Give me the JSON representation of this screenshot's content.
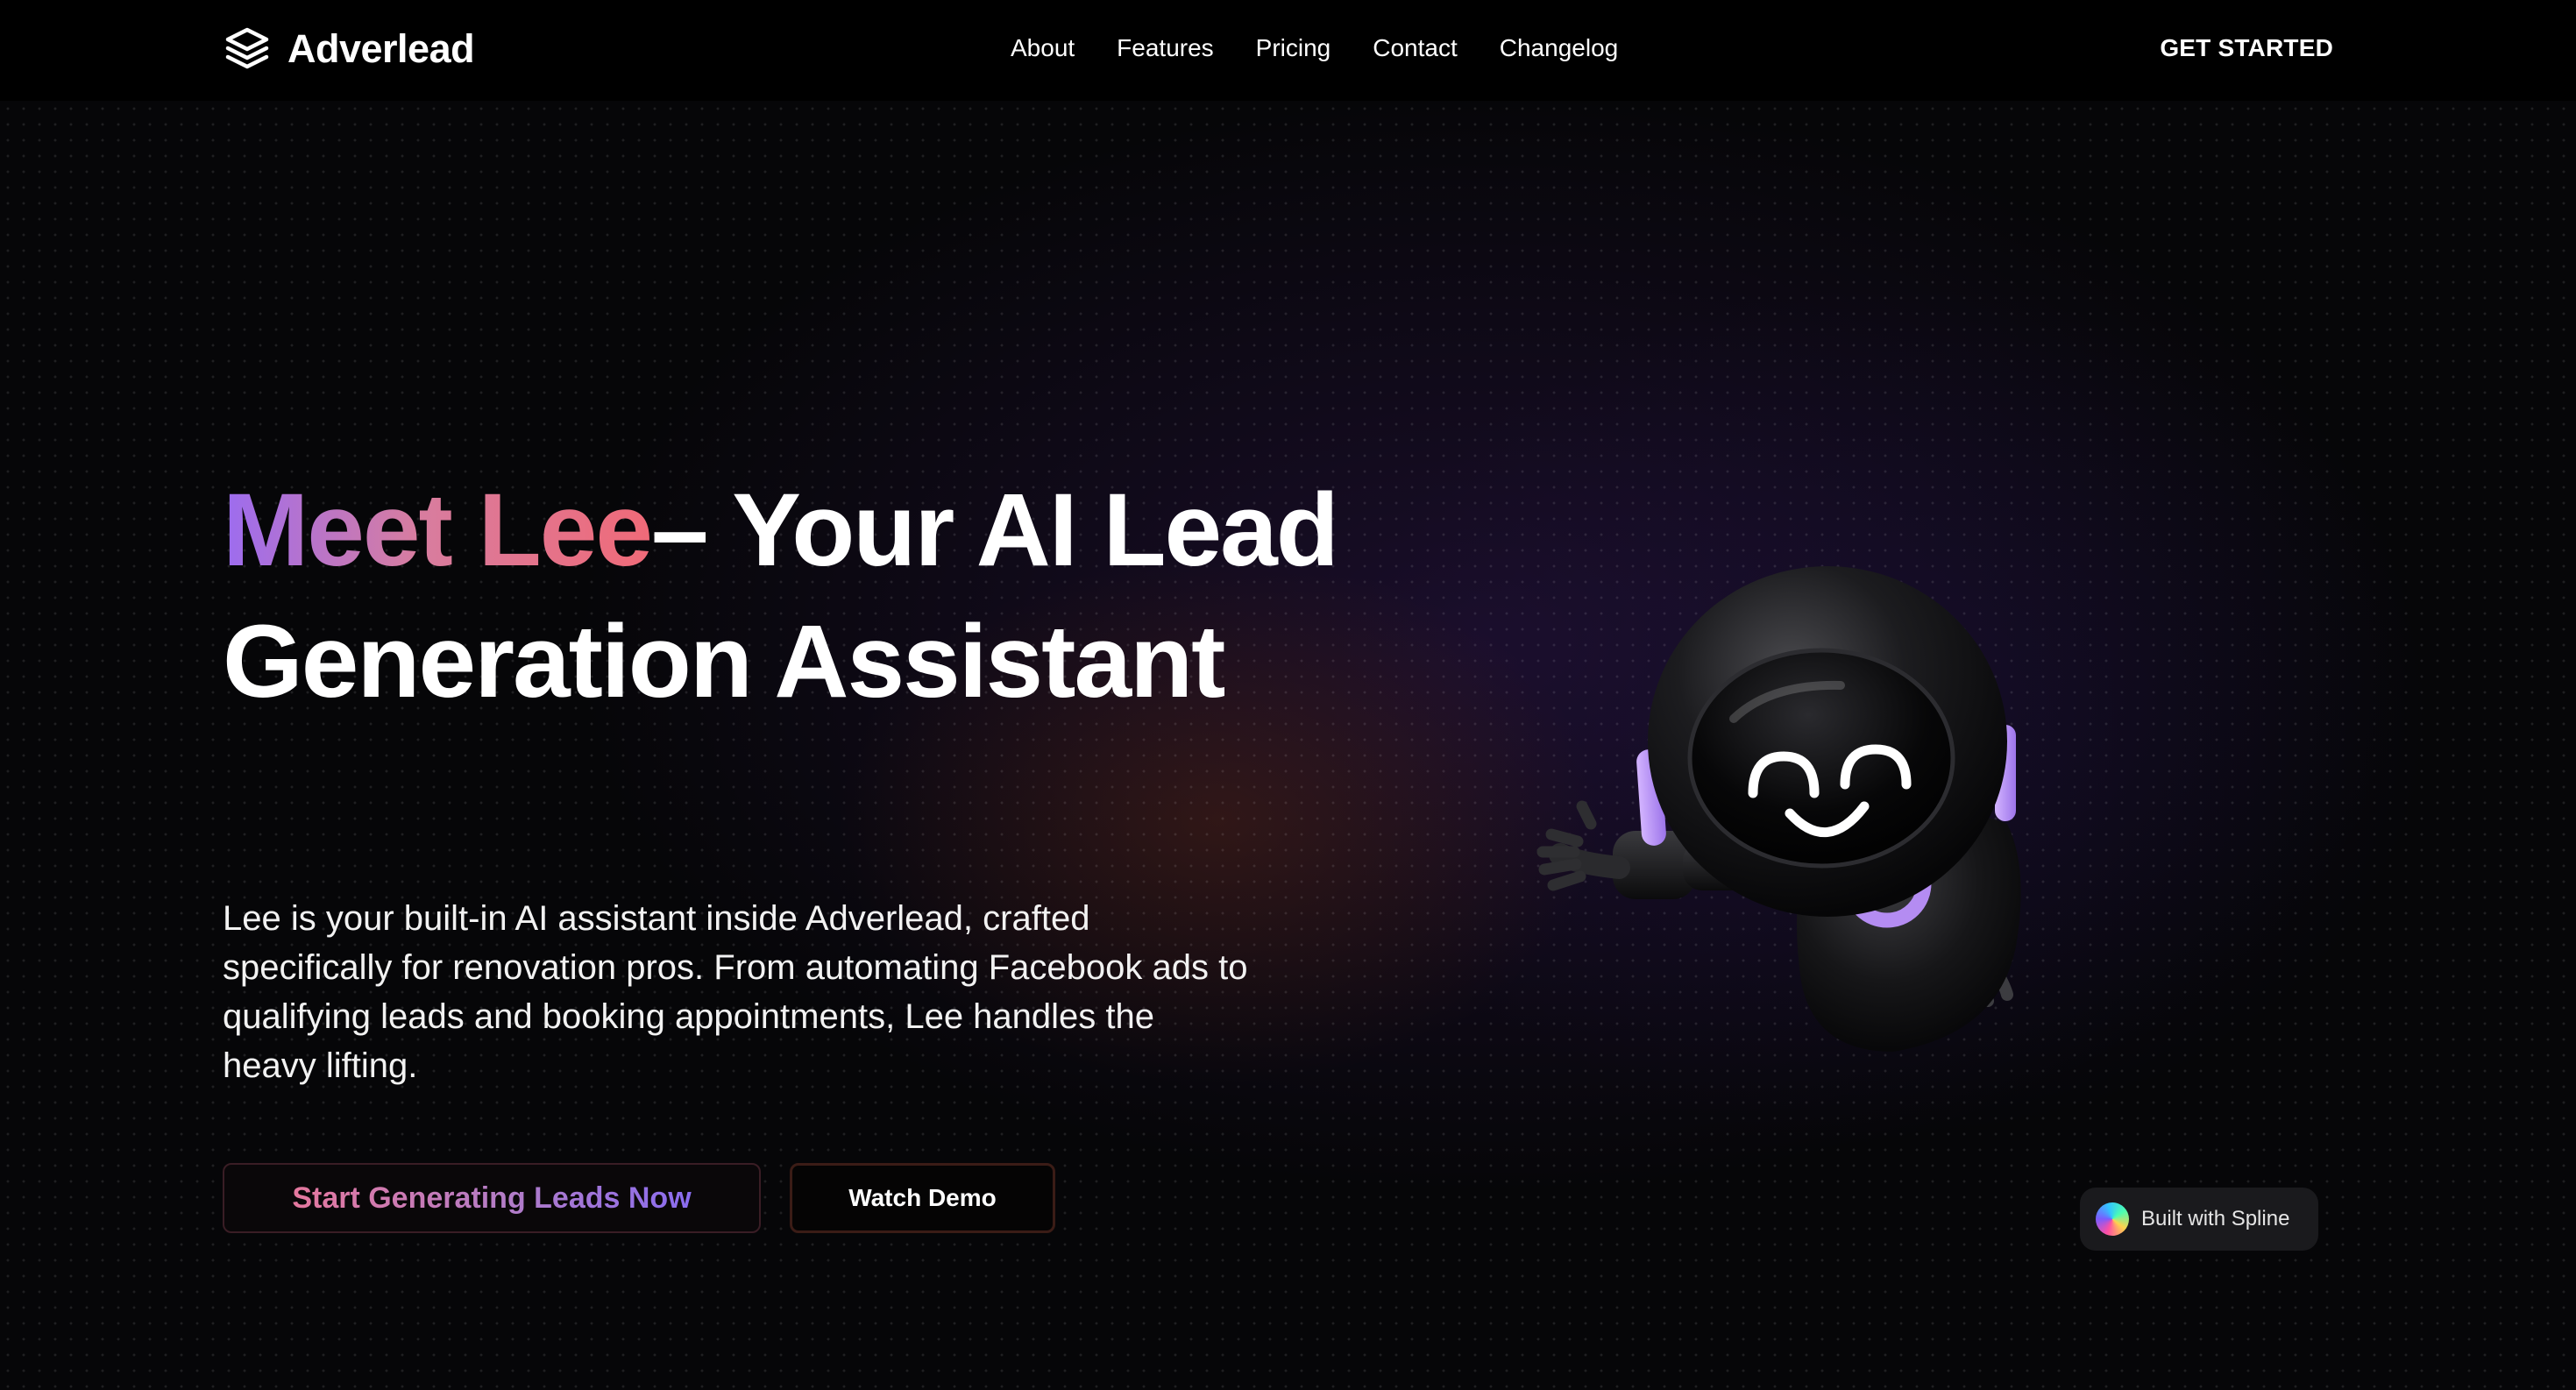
{
  "brand": {
    "name": "Adverlead",
    "logo_icon": "layers-icon"
  },
  "nav": {
    "items": [
      {
        "label": "About"
      },
      {
        "label": "Features"
      },
      {
        "label": "Pricing"
      },
      {
        "label": "Contact"
      },
      {
        "label": "Changelog"
      }
    ],
    "cta_label": "GET STARTED"
  },
  "hero": {
    "title_highlight": "Meet Lee",
    "title_rest": "– Your AI Lead Generation Assistant",
    "description": "Lee is your built-in AI assistant inside Adverlead, crafted specifically for renovation pros. From automating Facebook ads to qualifying leads and booking appointments, Lee handles the heavy lifting.",
    "primary_button": "Start Generating Leads Now",
    "secondary_button": "Watch Demo"
  },
  "badge": {
    "label": "Built with Spline",
    "icon": "spline-logo-icon"
  },
  "colors": {
    "background": "#000000",
    "accent_purple": "#9c6cf0",
    "accent_pink": "#f06a78",
    "robot_glow": "#b48cf2"
  }
}
